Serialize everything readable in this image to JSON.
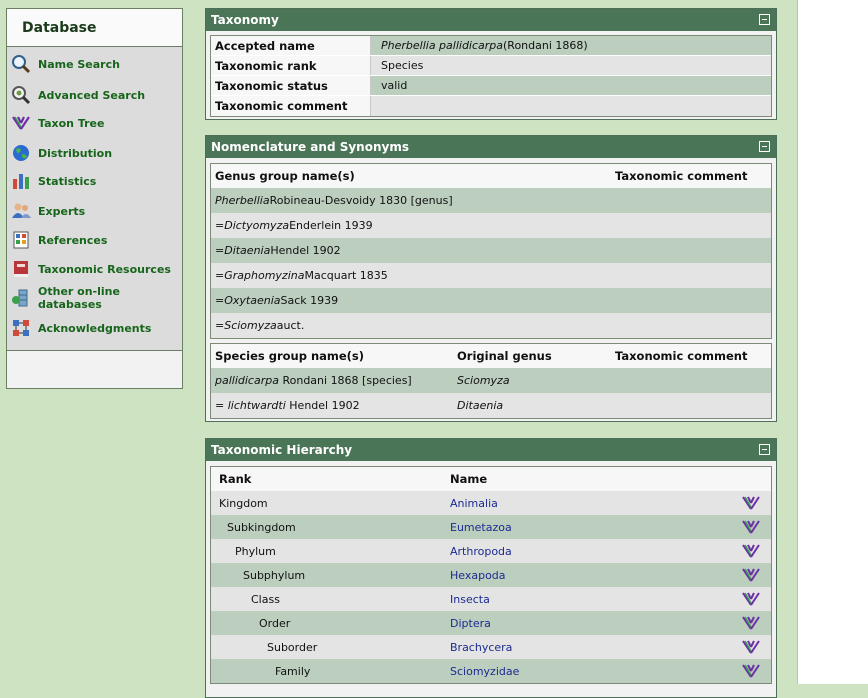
{
  "sidebar": {
    "title": "Database",
    "items": [
      {
        "label": "Name Search",
        "icon": "magnifier-icon"
      },
      {
        "label": "Advanced Search",
        "icon": "advanced-search-icon"
      },
      {
        "label": "Taxon Tree",
        "icon": "taxon-tree-icon"
      },
      {
        "label": "Distribution",
        "icon": "globe-icon"
      },
      {
        "label": "Statistics",
        "icon": "bar-chart-icon"
      },
      {
        "label": "Experts",
        "icon": "people-icon"
      },
      {
        "label": "References",
        "icon": "references-icon"
      },
      {
        "label": "Taxonomic Resources",
        "icon": "book-icon"
      },
      {
        "label": "Other on-line databases",
        "icon": "database-icon"
      },
      {
        "label": "Acknowledgments",
        "icon": "network-icon"
      }
    ]
  },
  "taxonomy": {
    "title": "Taxonomy",
    "rows": [
      {
        "key": "Accepted name",
        "value_italic": "Pherbellia pallidicarpa",
        "value_rest": " (Rondani 1868)"
      },
      {
        "key": "Taxonomic rank",
        "value_italic": "",
        "value_rest": "Species"
      },
      {
        "key": "Taxonomic status",
        "value_italic": "",
        "value_rest": "valid"
      },
      {
        "key": "Taxonomic comment",
        "value_italic": "",
        "value_rest": ""
      }
    ]
  },
  "nomenclature": {
    "title": "Nomenclature and Synonyms",
    "genus_headers": {
      "name": "Genus group name(s)",
      "comment": "Taxonomic comment"
    },
    "genus_rows": [
      {
        "prefix": "",
        "italic": "Pherbellia",
        "rest": " Robineau-Desvoidy 1830 [genus]"
      },
      {
        "prefix": "= ",
        "italic": "Dictyomyza",
        "rest": " Enderlein 1939"
      },
      {
        "prefix": "= ",
        "italic": "Ditaenia",
        "rest": " Hendel 1902"
      },
      {
        "prefix": "= ",
        "italic": "Graphomyzina",
        "rest": " Macquart 1835"
      },
      {
        "prefix": "= ",
        "italic": "Oxytaenia",
        "rest": " Sack 1939"
      },
      {
        "prefix": "= ",
        "italic": "Sciomyza",
        "rest": " auct."
      }
    ],
    "species_headers": {
      "name": "Species group name(s)",
      "genus": "Original genus",
      "comment": "Taxonomic comment"
    },
    "species_rows": [
      {
        "prefix": "",
        "italic": "pallidicarpa",
        "rest": " Rondani 1868 [species]",
        "genus": "Sciomyza"
      },
      {
        "prefix": "= ",
        "italic": "lichtwardti",
        "rest": " Hendel 1902",
        "genus": "Ditaenia"
      }
    ]
  },
  "hierarchy": {
    "title": "Taxonomic Hierarchy",
    "headers": {
      "rank": "Rank",
      "name": "Name"
    },
    "rows": [
      {
        "rank": "Kingdom",
        "name": "Animalia"
      },
      {
        "rank": "Subkingdom",
        "name": "Eumetazoa"
      },
      {
        "rank": "Phylum",
        "name": "Arthropoda"
      },
      {
        "rank": "Subphylum",
        "name": "Hexapoda"
      },
      {
        "rank": "Class",
        "name": "Insecta"
      },
      {
        "rank": "Order",
        "name": "Diptera"
      },
      {
        "rank": "Suborder",
        "name": "Brachycera"
      },
      {
        "rank": "Family",
        "name": "Sciomyzidae"
      }
    ]
  },
  "colors": {
    "page_bg": "#cde3c2",
    "panel_header": "#4a7556",
    "menu_text": "#17651b",
    "row_green": "#bccebe",
    "row_grey": "#e4e4e4",
    "link": "#1c2b8f"
  }
}
